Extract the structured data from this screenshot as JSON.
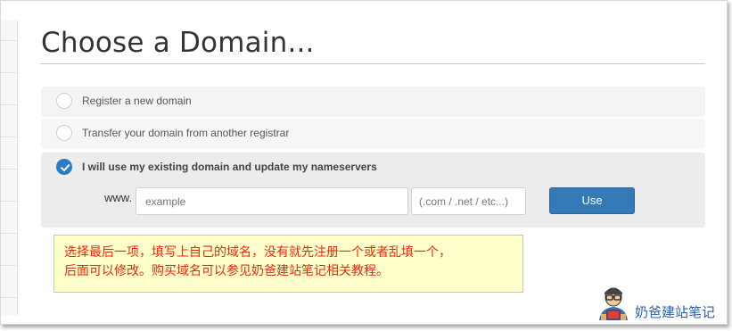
{
  "header": {
    "title": "Choose a Domain..."
  },
  "options": [
    {
      "label": "Register a new domain",
      "selected": false
    },
    {
      "label": "Transfer your domain from another registrar",
      "selected": false
    },
    {
      "label": "I will use my existing domain and update my nameservers",
      "selected": true
    }
  ],
  "domain_form": {
    "prefix": "www.",
    "sld_placeholder": "example",
    "tld_placeholder": "(.com / .net / etc...)",
    "submit_label": "Use"
  },
  "annotation": {
    "line1": "选择最后一项，填写上自己的域名，没有就先注册一个或者乱填一个，",
    "line2": "后面可以修改。购买域名可以参见奶爸建站笔记相关教程。"
  },
  "watermark": {
    "text": "奶爸建站笔记"
  },
  "colors": {
    "accent": "#337ab7",
    "check": "#2b7dc3",
    "note_text": "#e8280c",
    "note_bg": "#ffffcc"
  }
}
